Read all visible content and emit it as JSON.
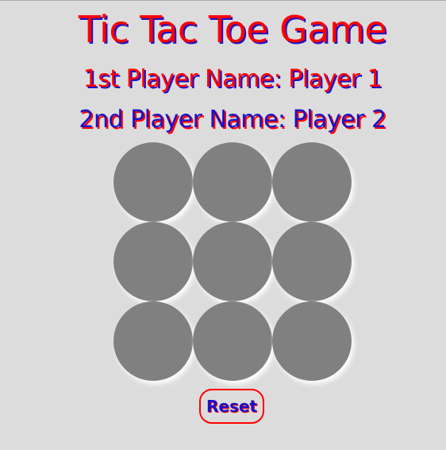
{
  "header": {
    "title": "Tic Tac Toe Game",
    "player1_label": "1st Player Name: Player 1",
    "player2_label": "2nd Player Name: Player 2"
  },
  "board": {
    "cells": [
      "",
      "",
      "",
      "",
      "",
      "",
      "",
      "",
      ""
    ]
  },
  "controls": {
    "reset_label": "Reset"
  },
  "colors": {
    "background": "#dcdcdc",
    "primary_red": "#ff0000",
    "primary_blue": "#1a12c8",
    "cell_fill": "#808080"
  }
}
